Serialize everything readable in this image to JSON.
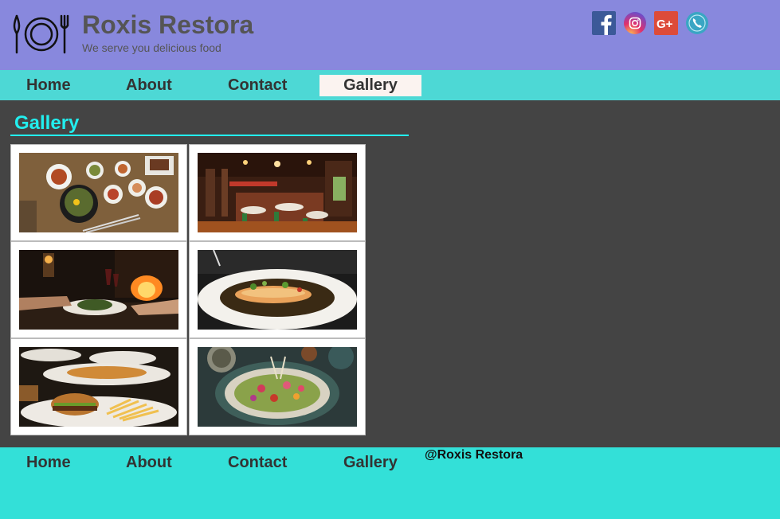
{
  "header": {
    "title": "Roxis Restora",
    "tagline": "We serve you delicious food",
    "logo_icon": "utensils-plate-icon",
    "social": [
      {
        "name": "facebook-icon",
        "color": "#3b5998"
      },
      {
        "name": "instagram-icon",
        "color": "#e1306c"
      },
      {
        "name": "google-plus-icon",
        "color": "#dd4b39"
      },
      {
        "name": "phone-icon",
        "color": "#3aa6c4"
      }
    ]
  },
  "nav": {
    "items": [
      "Home",
      "About",
      "Contact",
      "Gallery"
    ],
    "active": "Gallery"
  },
  "gallery": {
    "title": "Gallery",
    "images": [
      "Korean dishes on wooden table",
      "Restaurant dining room interior",
      "Candlelit dinner by fireplace",
      "Plated fish with sauce",
      "Burgers and fries on plates",
      "Salad platter with edible flowers"
    ]
  },
  "footer": {
    "items": [
      "Home",
      "About",
      "Contact",
      "Gallery"
    ],
    "copyright": "@Roxis Restora"
  },
  "colors": {
    "header_bg": "#8888dd",
    "nav_bg": "#4dd8d5",
    "content_bg": "#444444",
    "accent": "#22eeee",
    "footer_bg": "#33e0d8"
  }
}
